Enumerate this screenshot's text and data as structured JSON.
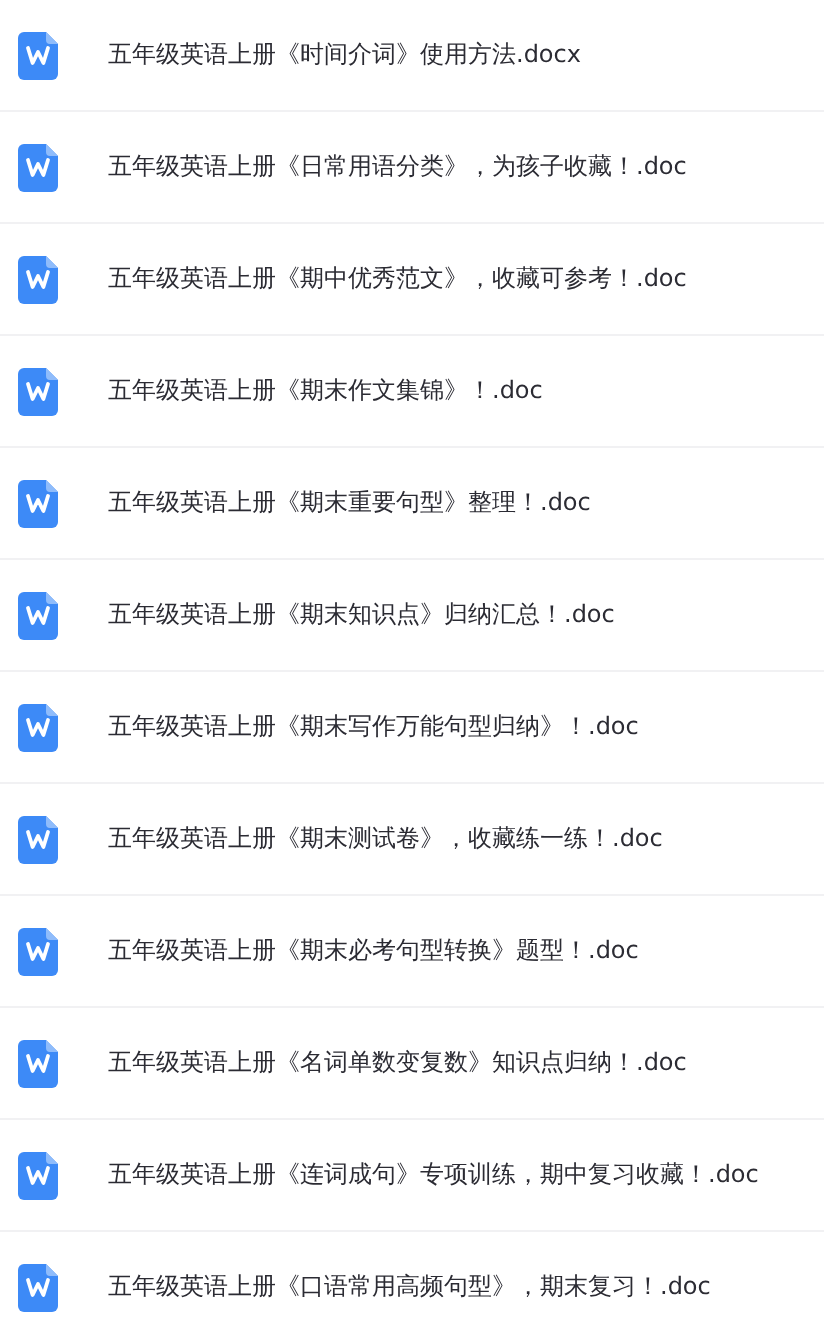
{
  "files": [
    {
      "name": "五年级英语上册《时间介词》使用方法.docx"
    },
    {
      "name": "五年级英语上册《日常用语分类》，为孩子收藏！.doc"
    },
    {
      "name": "五年级英语上册《期中优秀范文》，收藏可参考！.doc"
    },
    {
      "name": "五年级英语上册《期末作文集锦》！.doc"
    },
    {
      "name": "五年级英语上册《期末重要句型》整理！.doc"
    },
    {
      "name": "五年级英语上册《期末知识点》归纳汇总！.doc"
    },
    {
      "name": "五年级英语上册《期末写作万能句型归纳》！.doc"
    },
    {
      "name": "五年级英语上册《期末测试卷》，收藏练一练！.doc"
    },
    {
      "name": "五年级英语上册《期末必考句型转换》题型！.doc"
    },
    {
      "name": "五年级英语上册《名词单数变复数》知识点归纳！.doc"
    },
    {
      "name": "五年级英语上册《连词成句》专项训练，期中复习收藏！.doc"
    },
    {
      "name": "五年级英语上册《口语常用高频句型》，期末复习！.doc"
    }
  ]
}
